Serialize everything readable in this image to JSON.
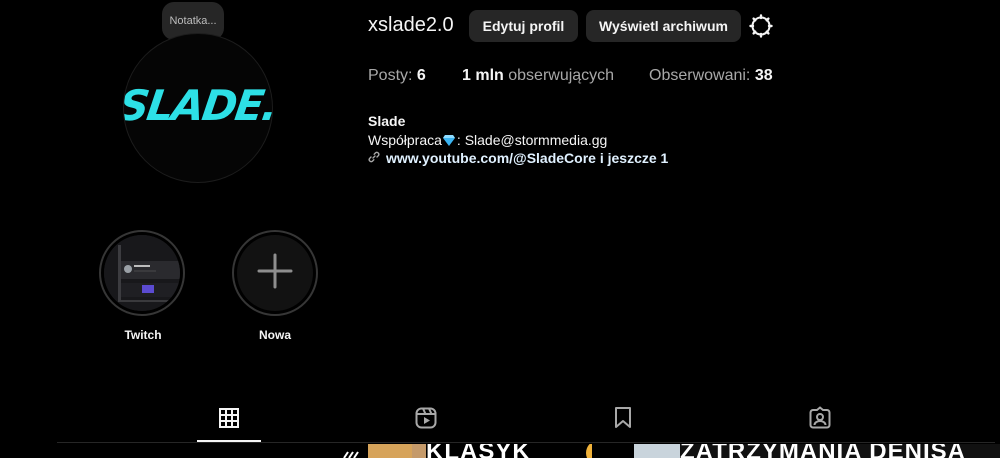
{
  "note": {
    "text": "Notatka..."
  },
  "profile": {
    "username": "xslade2.0",
    "avatar_text": "SLADE."
  },
  "buttons": {
    "edit_profile": "Edytuj profil",
    "view_archive": "Wyświetl archiwum"
  },
  "stats": {
    "posts_label": "Posty:",
    "posts_value": "6",
    "followers_value": "1 mln",
    "followers_label": "obserwujących",
    "following_label": "Obserwowani:",
    "following_value": "38"
  },
  "bio": {
    "name": "Slade",
    "cooperation_prefix": "Współpraca",
    "cooperation_suffix": ": Slade@stormmedia.gg",
    "link_text": "www.youtube.com/@SladeCore i jeszcze 1"
  },
  "highlights": [
    {
      "label": "Twitch"
    },
    {
      "label": "Nowa"
    }
  ],
  "tabs": [
    {
      "name": "posts-grid",
      "active": true
    },
    {
      "name": "reels"
    },
    {
      "name": "saved"
    },
    {
      "name": "tagged"
    }
  ],
  "thumbnails": {
    "text_1": "KLASYK",
    "text_2": "ZATRZYMANIA DENISA"
  },
  "colors": {
    "accent_logo": "#2de0e6",
    "background": "#000000",
    "button_bg": "#262626"
  }
}
